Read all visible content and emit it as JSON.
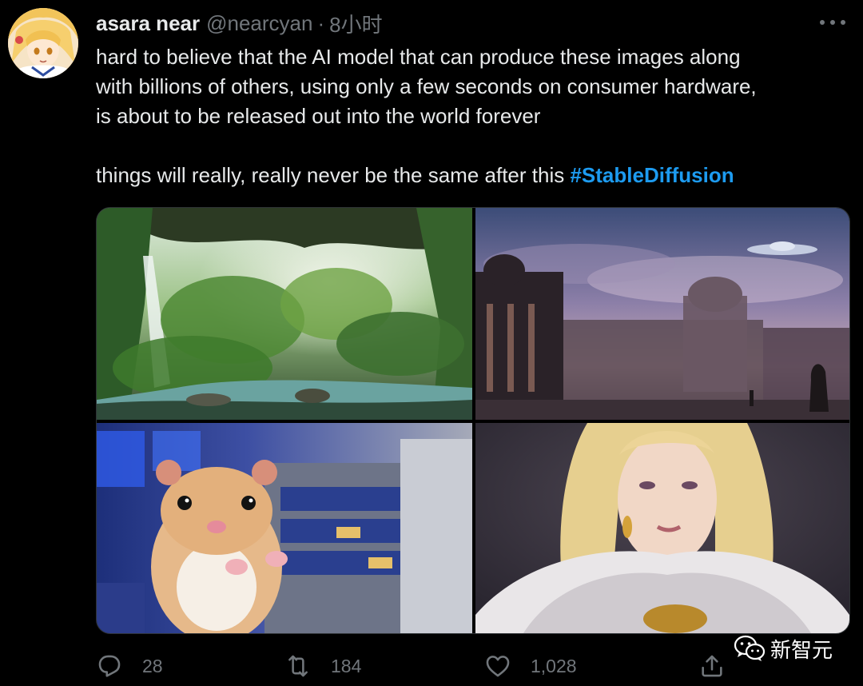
{
  "tweet": {
    "display_name": "asara near",
    "handle": "@nearcyan",
    "separator": "·",
    "time": "8小时",
    "text_lines": [
      "hard to believe that the AI model that can produce these images along",
      "with billions of others, using only a few seconds on consumer hardware,",
      "is about to be released out into the world forever"
    ],
    "text2": "things will really, really never be the same after this ",
    "hashtag": "#StableDiffusion"
  },
  "media": [
    {
      "icon": "jungle-cave-waterfall-image"
    },
    {
      "icon": "ancient-city-ufo-image"
    },
    {
      "icon": "hamster-spaceship-image"
    },
    {
      "icon": "blonde-woman-portrait-image"
    }
  ],
  "actions": {
    "reply_count": "28",
    "retweet_count": "184",
    "like_count": "1,028"
  },
  "watermark": {
    "label": "新智元"
  },
  "colors": {
    "background": "#000000",
    "text": "#e7e9ea",
    "muted": "#71767b",
    "accent": "#1d9bf0"
  }
}
